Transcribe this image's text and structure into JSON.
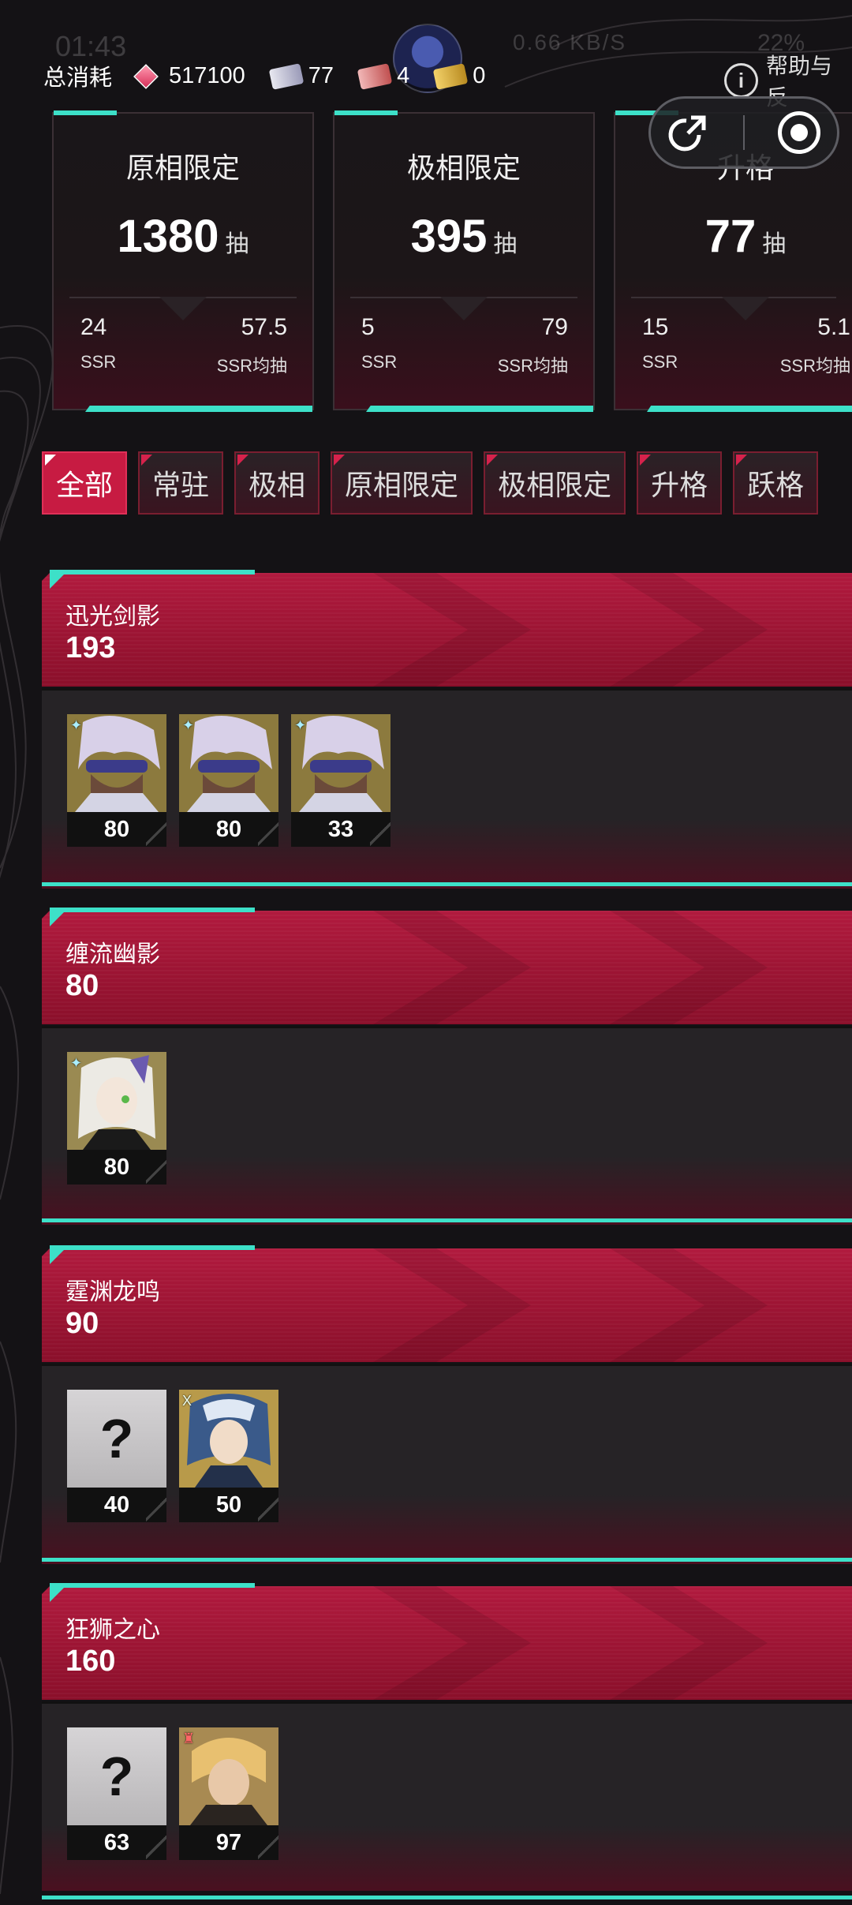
{
  "status": {
    "clock": "01:43",
    "speed": "0.66 KB/S",
    "battery": "22%"
  },
  "top": {
    "total_label": "总消耗",
    "currencies": [
      {
        "icon": "diamond-gem-icon",
        "value": "517100"
      },
      {
        "icon": "silver-ticket-icon",
        "value": "77"
      },
      {
        "icon": "red-ticket-icon",
        "value": "4"
      },
      {
        "icon": "gold-ticket-icon",
        "value": "0"
      }
    ],
    "help_label": "帮助与反"
  },
  "cards": [
    {
      "title": "原相限定",
      "count": "1380",
      "unit": "抽",
      "ssr": "24",
      "ssr_label": "SSR",
      "avg": "57.5",
      "avg_label": "SSR均抽"
    },
    {
      "title": "极相限定",
      "count": "395",
      "unit": "抽",
      "ssr": "5",
      "ssr_label": "SSR",
      "avg": "79",
      "avg_label": "SSR均抽"
    },
    {
      "title": "升格",
      "count": "77",
      "unit": "抽",
      "ssr": "15",
      "ssr_label": "SSR",
      "avg": "5.1",
      "avg_label": "SSR均抽"
    }
  ],
  "tabs": [
    "全部",
    "常驻",
    "极相",
    "原相限定",
    "极相限定",
    "升格",
    "跃格"
  ],
  "active_tab": "全部",
  "banners": [
    {
      "name": "迅光剑影",
      "total": "193",
      "pulls": [
        {
          "kind": "char-a",
          "num": "80"
        },
        {
          "kind": "char-a",
          "num": "80"
        },
        {
          "kind": "char-a",
          "num": "33"
        }
      ]
    },
    {
      "name": "缠流幽影",
      "total": "80",
      "pulls": [
        {
          "kind": "char-b",
          "num": "80"
        }
      ]
    },
    {
      "name": "霆渊龙鸣",
      "total": "90",
      "pulls": [
        {
          "kind": "unknown",
          "num": "40",
          "text": "?"
        },
        {
          "kind": "char-c",
          "num": "50"
        }
      ]
    },
    {
      "name": "狂狮之心",
      "total": "160",
      "pulls": [
        {
          "kind": "unknown",
          "num": "63",
          "text": "?"
        },
        {
          "kind": "char-d",
          "num": "97"
        }
      ]
    }
  ],
  "colors": {
    "accent_red": "#c71b42",
    "accent_teal": "#3de0c8",
    "bg": "#141215"
  }
}
